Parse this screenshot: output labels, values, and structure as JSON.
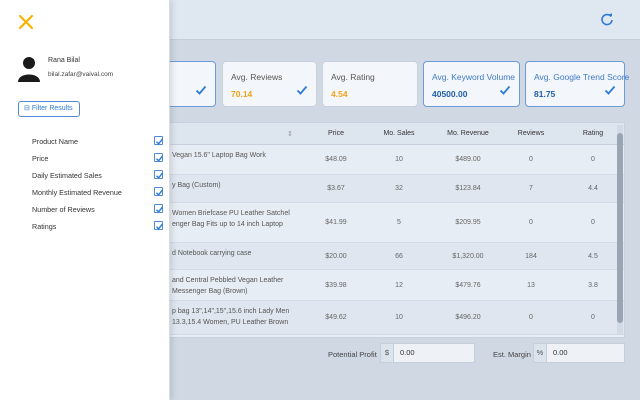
{
  "colors": {
    "accent": "#2f7bd8",
    "orange": "#f0a31c",
    "navy": "#1f5fa8",
    "close_icon": "#f5b400"
  },
  "sidebar": {
    "user_name": "Rana Bilal",
    "user_email": "bilal.zafar@vaival.com",
    "filter_button_label": "Filter Results",
    "filters": [
      {
        "label": "Product Name",
        "checked": true
      },
      {
        "label": "Price",
        "checked": true
      },
      {
        "label": "Daily Estimated Sales",
        "checked": true
      },
      {
        "label": "Monthly Estimated Revenue",
        "checked": true
      },
      {
        "label": "Number of Reviews",
        "checked": true
      },
      {
        "label": "Ratings",
        "checked": true
      }
    ]
  },
  "cards": [
    {
      "label": "",
      "value": "",
      "checked": true
    },
    {
      "label": "Avg. Reviews",
      "value": "70.14",
      "checked": true
    },
    {
      "label": "Avg. Rating",
      "value": "4.54",
      "checked": false
    },
    {
      "label": "Avg. Keyword Volume",
      "value": "40500.00",
      "checked": true
    },
    {
      "label": "Avg. Google Trend Score",
      "value": "81.75",
      "checked": true
    }
  ],
  "table": {
    "columns": [
      "Price",
      "Mo. Sales",
      "Mo. Revenue",
      "Reviews",
      "Rating"
    ],
    "rows": [
      {
        "name": "Vegan 15.6\" Laptop Bag Work",
        "price": "$48.09",
        "sales": "10",
        "revenue": "$489.00",
        "reviews": "0",
        "rating": "0"
      },
      {
        "name": "y Bag (Custom)",
        "price": "$3.67",
        "sales": "32",
        "revenue": "$123.84",
        "reviews": "7",
        "rating": "4.4"
      },
      {
        "name": "Women Briefcase PU Leather Satchel\nenger Bag Fits up to 14 inch Laptop",
        "price": "$41.99",
        "sales": "5",
        "revenue": "$209.95",
        "reviews": "0",
        "rating": "0"
      },
      {
        "name": "d Notebook carrying case",
        "price": "$20.00",
        "sales": "66",
        "revenue": "$1,320.00",
        "reviews": "184",
        "rating": "4.5"
      },
      {
        "name": "and Central Pebbled Vegan Leather\nMessenger Bag (Brown)",
        "price": "$39.98",
        "sales": "12",
        "revenue": "$479.76",
        "reviews": "13",
        "rating": "3.8"
      },
      {
        "name": "p bag 13\",14\",15\",15.6 inch Lady Men\n13.3,15.4 Women, PU Leather Brown",
        "price": "$49.62",
        "sales": "10",
        "revenue": "$496.20",
        "reviews": "0",
        "rating": "0"
      }
    ]
  },
  "footer": {
    "potential_profit_label": "Potential Profit",
    "profit_addon": "$",
    "profit_value": "0.00",
    "margin_label": "Est. Margin",
    "margin_addon": "%",
    "margin_value": "0.00"
  }
}
